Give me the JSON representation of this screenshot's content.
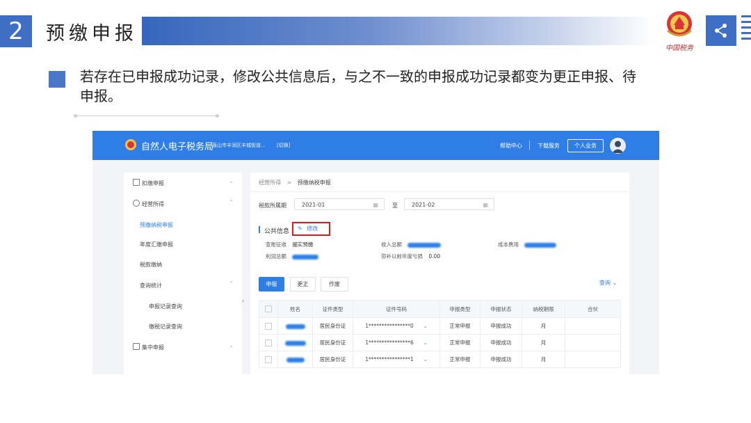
{
  "slide": {
    "number": "2",
    "title": "预缴申报",
    "emblem_caption": "中国税务",
    "bullet": "若存在已申报成功记录，修改公共信息后，与之不一致的申报成功记录都变为更正申报、待申报。"
  },
  "colors": {
    "slide_accent": "#3f6fc4",
    "app_header": "#2f7ee6",
    "highlight_box": "#e01818"
  },
  "app": {
    "header": {
      "name": "自然人电子税务局",
      "region": "唐山市丰润区丰城街道...",
      "switch": "[切换]",
      "help": "帮助中心",
      "download": "下载服务",
      "personal": "个人业务"
    },
    "sidebar": [
      {
        "label": "扣缴申报",
        "icon": "document-icon",
        "chevron": "⌄",
        "level": 0
      },
      {
        "label": "经营所得",
        "icon": "coin-icon",
        "chevron": "⌃",
        "level": 0
      },
      {
        "label": "预缴纳税申报",
        "active": true,
        "level": 1
      },
      {
        "label": "年度汇缴申报",
        "level": 1
      },
      {
        "label": "税款缴纳",
        "level": 1
      },
      {
        "label": "查询统计",
        "chevron": "⌃",
        "level": 1
      },
      {
        "label": "申报记录查询",
        "level": 2
      },
      {
        "label": "缴税记录查询",
        "level": 2
      },
      {
        "label": "集中申报",
        "icon": "folder-icon",
        "chevron": "⌄",
        "level": 0
      }
    ],
    "main": {
      "breadcrumb": {
        "parent": "经营所得",
        "sep": ">",
        "current": "预缴纳税申报"
      },
      "period_label": "税款所属期",
      "period_from": "2021-01",
      "period_to_label": "至",
      "period_to": "2021-02",
      "public_info": {
        "title": "公共信息",
        "edit_label": "修改",
        "collect_method_label": "查账征收",
        "collect_method_value": "据实预缴",
        "income_label": "收入总额",
        "cost_label": "成本费用",
        "profit_label": "利润总额",
        "loss_label": "弥补以前年度亏损",
        "loss_value": "0.00"
      },
      "buttons": {
        "declare": "申报",
        "correct": "更正",
        "void": "作废"
      },
      "query_label": "查询",
      "table": {
        "headers": [
          "姓名",
          "证件类型",
          "证件号码",
          "申报类型",
          "申报状态",
          "纳税期限",
          "合伙"
        ],
        "rows": [
          {
            "id_type": "居民身份证",
            "id_number": "1****************0",
            "declare_type": "正常申报",
            "status": "申报成功",
            "period": "月"
          },
          {
            "id_type": "居民身份证",
            "id_number": "1****************6",
            "declare_type": "正常申报",
            "status": "申报成功",
            "period": "月"
          },
          {
            "id_type": "居民身份证",
            "id_number": "1****************1",
            "declare_type": "正常申报",
            "status": "申报成功",
            "period": "月"
          }
        ]
      }
    }
  }
}
